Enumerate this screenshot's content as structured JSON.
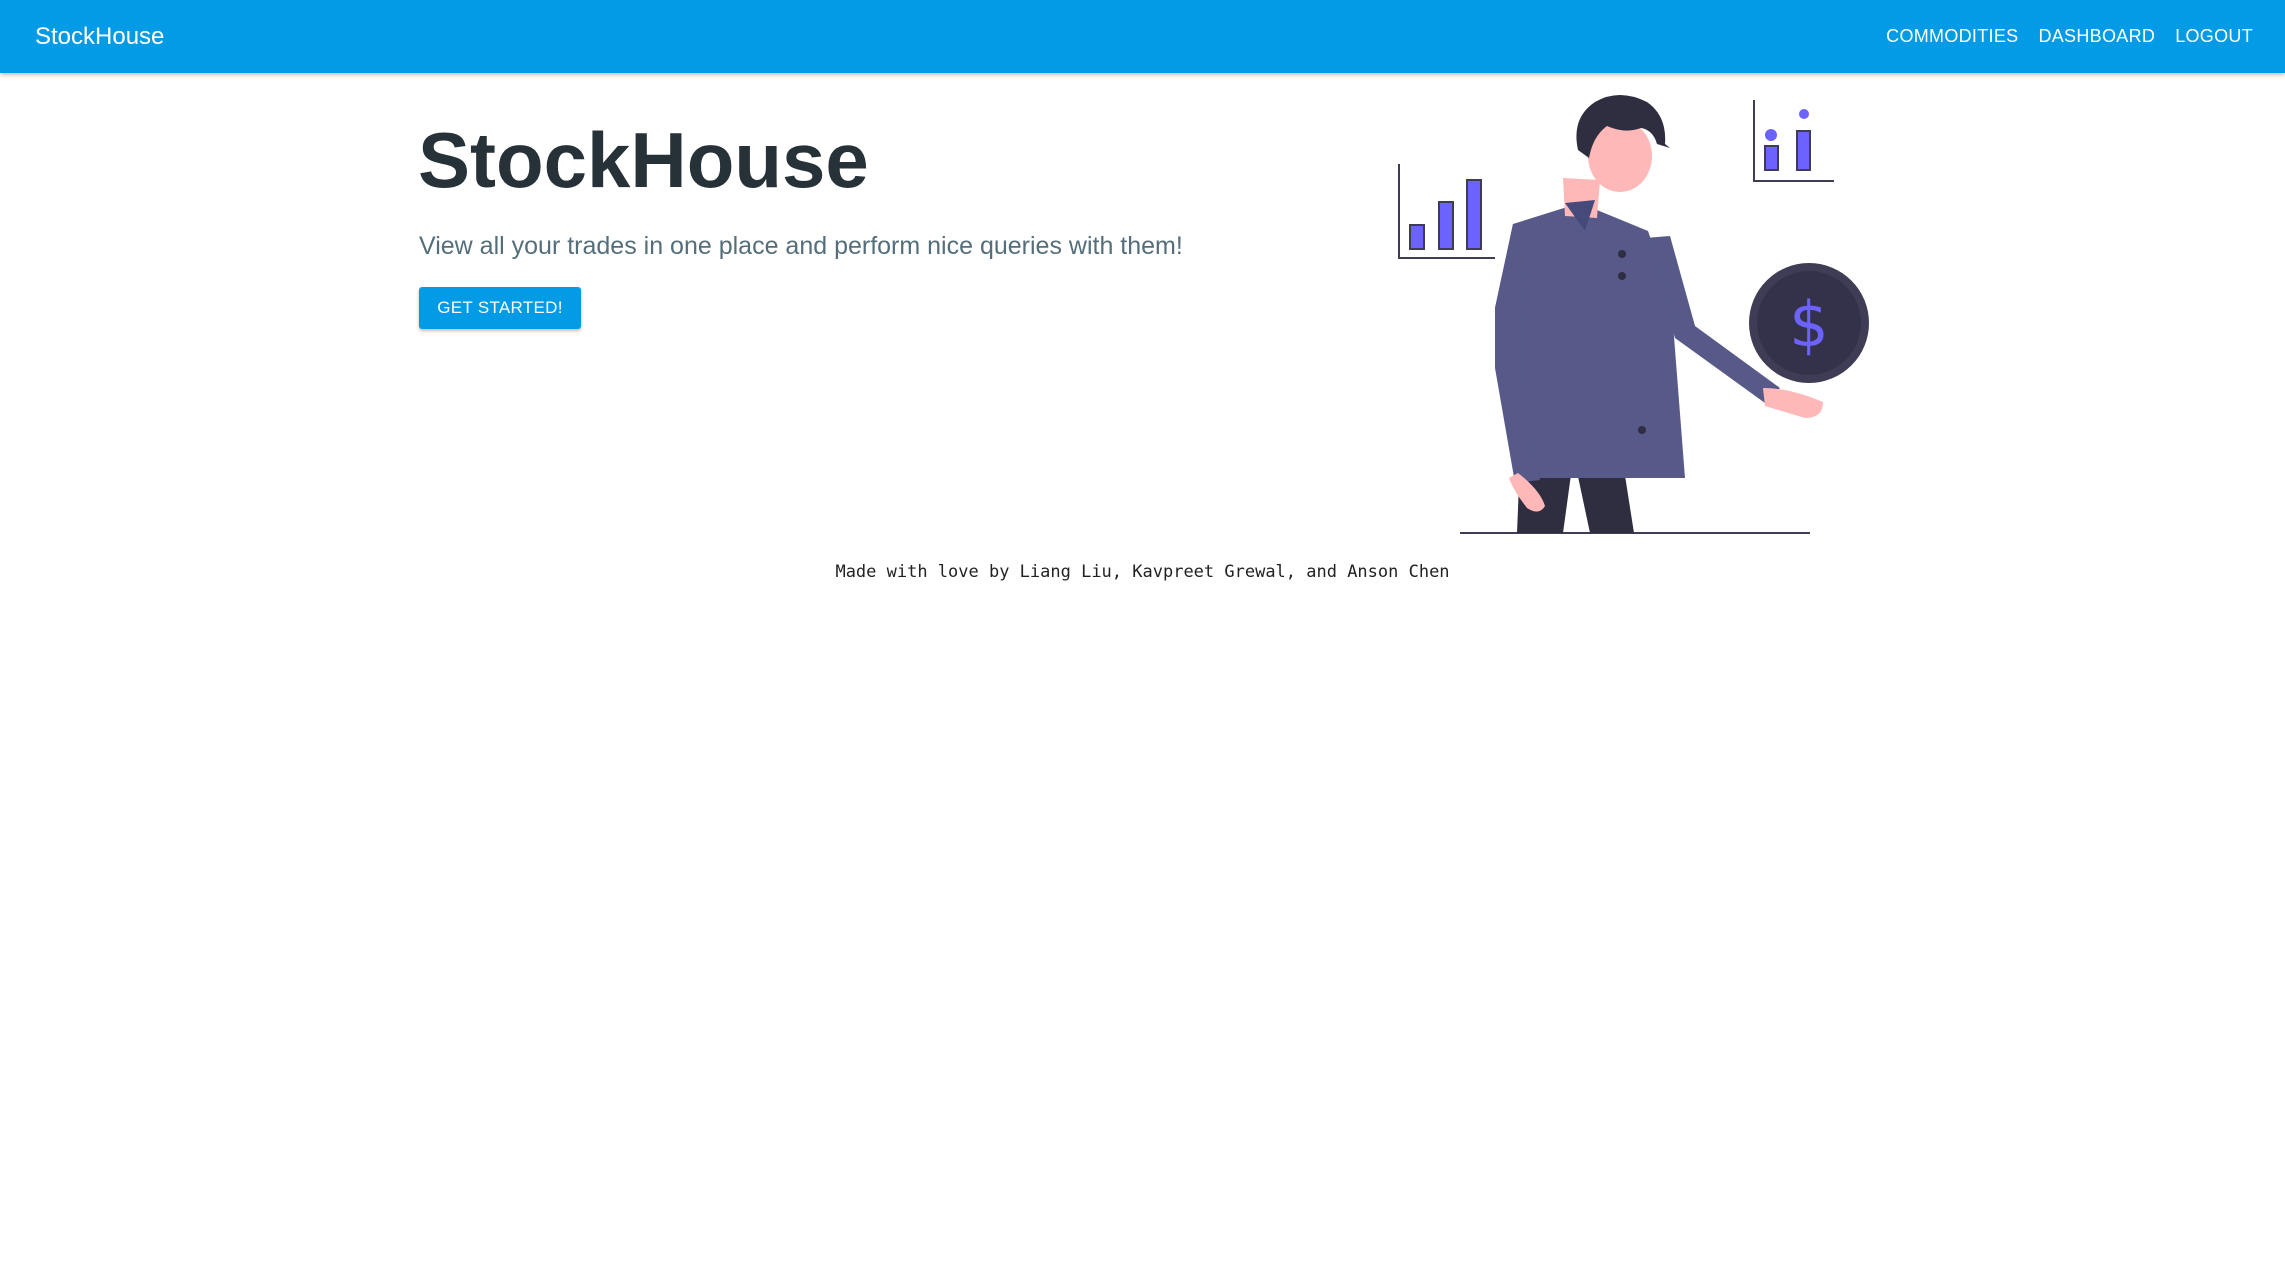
{
  "header": {
    "brand": "StockHouse",
    "nav": [
      "COMMODITIES",
      "DASHBOARD",
      "LOGOUT"
    ],
    "color": "#039be5"
  },
  "hero": {
    "title": "StockHouse",
    "subtitle": "View all your trades in one place and perform nice queries with them!",
    "cta_label": "GET STARTED!"
  },
  "illustration": {
    "coin_symbol": "$"
  },
  "footer": {
    "text": "Made with love by Liang Liu, Kavpreet Grewal, and Anson Chen"
  }
}
